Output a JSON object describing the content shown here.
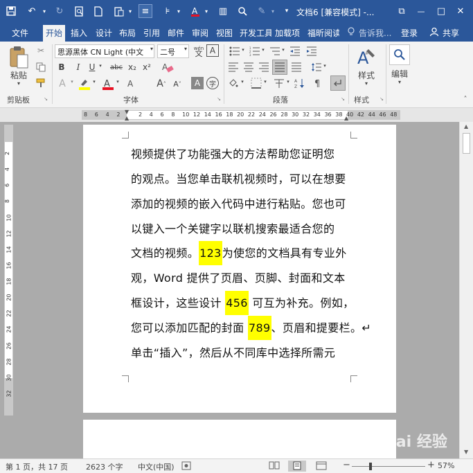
{
  "window": {
    "title": "文档6 [兼容模式] -...",
    "controls": {
      "restore": "⧉",
      "minimize": "—",
      "maximize": "□",
      "close": "✕"
    }
  },
  "tabs": {
    "file": "文件",
    "home": "开始",
    "insert": "插入",
    "design": "设计",
    "layout": "布局",
    "references": "引用",
    "mailings": "邮件",
    "review": "审阅",
    "view": "视图",
    "developer": "开发工具",
    "addins": "加载项",
    "foxit": "福昕阅读",
    "tellme": "告诉我...",
    "login": "登录",
    "share": "共享"
  },
  "ribbon": {
    "paste": "粘贴",
    "clipboard_group": "剪贴板",
    "font_name": "思源黑体 CN Light (中文",
    "font_size": "二号",
    "font_group": "字体",
    "paragraph_group": "段落",
    "styles": "样式",
    "styles_group": "样式",
    "editing": "编辑",
    "bold": "B",
    "italic": "I",
    "underline": "U",
    "strike": "abc",
    "subscript": "x₂",
    "superscript": "x²",
    "font_color": "A",
    "char_shade": "A",
    "enclose": "字",
    "pinyin": "wén"
  },
  "ruler": {
    "h_numbers": [
      "8",
      "6",
      "4",
      "2",
      "",
      "2",
      "4",
      "6",
      "8",
      "10",
      "12",
      "14",
      "16",
      "18",
      "20",
      "22",
      "24",
      "26",
      "28",
      "30",
      "32",
      "34",
      "36",
      "38",
      "40",
      "42",
      "44",
      "46",
      "48"
    ],
    "v_numbers": [
      "2",
      "4",
      "6",
      "8",
      "10",
      "12",
      "14",
      "16",
      "18",
      "20",
      "22",
      "24",
      "26",
      "28",
      "30",
      "32"
    ]
  },
  "document": {
    "lines": [
      {
        "text": "视频提供了功能强大的方法帮助您证明您"
      },
      {
        "text": "的观点。当您单击联机视频时，可以在想要"
      },
      {
        "text": "添加的视频的嵌入代码中进行粘贴。您也可"
      },
      {
        "text": "以键入一个关键字以联机搜索最适合您的"
      },
      {
        "pre": "文档的视频。",
        "hl": "123",
        "post": "为使您的文档具有专业外"
      },
      {
        "text": "观，Word 提供了页眉、页脚、封面和文本"
      },
      {
        "pre": "框设计，这些设计 ",
        "hl": "456",
        "post": " 可互为补充。例如，"
      },
      {
        "pre": "您可以添加匹配的封面 ",
        "hl": "789",
        "post": "、页眉和提要栏。↵"
      },
      {
        "text": "单击“插入”，然后从不同库中选择所需元"
      }
    ]
  },
  "status": {
    "page": "第 1 页，共 17 页",
    "words": "2623 个字",
    "lang": "中文(中国)",
    "zoom": "57%",
    "zoom_minus": "−",
    "zoom_plus": "+"
  },
  "watermark": "Bai 经验",
  "colors": {
    "brand": "#2b579a",
    "highlight": "#ffff00",
    "font_red": "#e81123"
  }
}
